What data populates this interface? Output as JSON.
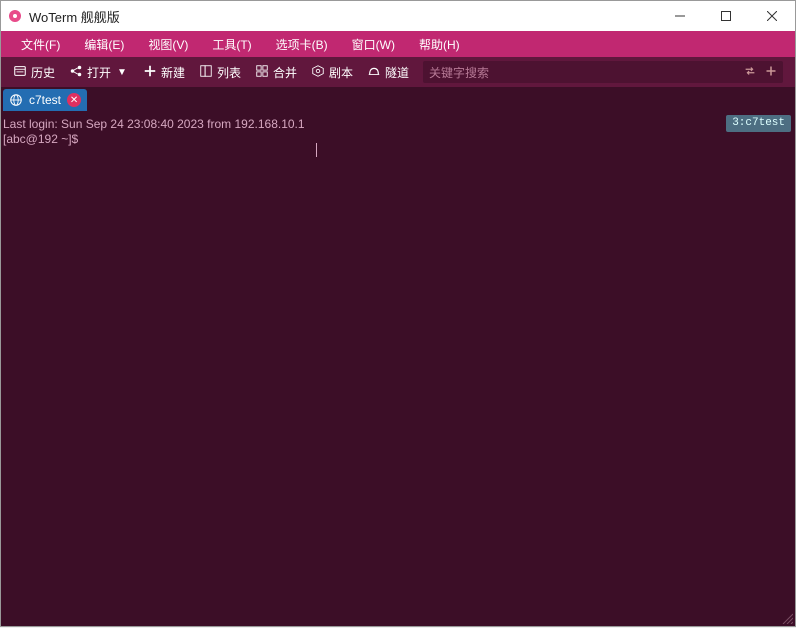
{
  "window": {
    "title": "WoTerm 舰舰版"
  },
  "menu": {
    "file": "文件(F)",
    "edit": "编辑(E)",
    "view": "视图(V)",
    "tool": "工具(T)",
    "tab": "选项卡(B)",
    "window": "窗口(W)",
    "help": "帮助(H)"
  },
  "toolbar": {
    "history": "历史",
    "open": "打开",
    "new": "新建",
    "list": "列表",
    "merge": "合并",
    "script": "剧本",
    "tunnel": "隧道",
    "search_placeholder": "关键字搜索"
  },
  "tab": {
    "label": "c7test"
  },
  "terminal": {
    "line1": "Last login: Sun Sep 24 23:08:40 2023 from 192.168.10.1",
    "line2": "[abc@192 ~]$",
    "status": "3:c7test"
  }
}
